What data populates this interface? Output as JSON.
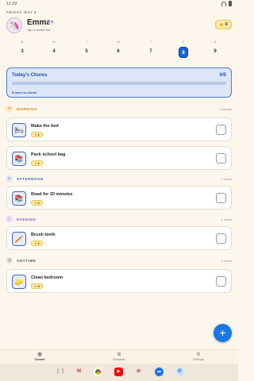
{
  "status": {
    "time": "11:29"
  },
  "date_line": "FRIDAY, MAY 8",
  "profile": {
    "name": "Emma",
    "subtitle": "Tap to switch kid",
    "stars": "0"
  },
  "week": [
    {
      "letter": "S",
      "num": "3"
    },
    {
      "letter": "M",
      "num": "4"
    },
    {
      "letter": "T",
      "num": "5"
    },
    {
      "letter": "W",
      "num": "6"
    },
    {
      "letter": "T",
      "num": "7"
    },
    {
      "letter": "F",
      "num": "8"
    },
    {
      "letter": "S",
      "num": "9"
    }
  ],
  "selected_day_index": 5,
  "today": {
    "title": "Today's Chores",
    "count": "0/5",
    "progress": 0,
    "more": "5 more to crush!"
  },
  "sections": {
    "morning": {
      "label": "MORNING",
      "count": "2 chores",
      "color": "#c98a1a",
      "icon_bg": "#fbe5b8"
    },
    "afternoon": {
      "label": "AFTERNOON",
      "count": "1 chore",
      "color": "#3f63b8",
      "icon_bg": "#d9e4f6"
    },
    "evening": {
      "label": "EVENING",
      "count": "1 chore",
      "color": "#8a4fc4",
      "icon_bg": "#eadcf6"
    },
    "anytime": {
      "label": "ANYTIME",
      "count": "1 chore",
      "color": "#555555",
      "icon_bg": "#e4e4e4"
    }
  },
  "chores": [
    {
      "name": "Make the bed",
      "points": "1",
      "icon": "🛏"
    },
    {
      "name": "Pack school bag",
      "points": "1",
      "icon": "📚"
    },
    {
      "name": "Read for 20 minutes",
      "points": "2",
      "icon": "📚"
    },
    {
      "name": "Brush teeth",
      "points": "1",
      "icon": "🪥"
    },
    {
      "name": "Clean bedroom",
      "points": "3",
      "icon": "🧽"
    }
  ],
  "nav": {
    "chores": "Chores",
    "rewards": "Rewards",
    "settings": "Settings"
  },
  "colors": {
    "accent": "#1a78e6",
    "selected_day": "#1a66d6",
    "today_border": "#4b7ad1"
  }
}
